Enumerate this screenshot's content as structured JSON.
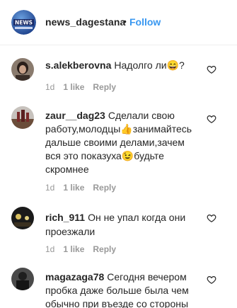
{
  "header": {
    "username": "news_dagestana",
    "separator": "•",
    "follow_label": "Follow",
    "avatar_text": "NEWS"
  },
  "comments": [
    {
      "username": "s.alekberovna",
      "text": "Надолго ли😄?",
      "time": "1d",
      "likes": "1 like",
      "reply": "Reply"
    },
    {
      "username": "zaur__dag23",
      "text": "Сделали свою работу,молодцы👍занимайтесь дальше своими делами,зачем вся это показуха😉будьте скромнее",
      "time": "1d",
      "likes": "1 like",
      "reply": "Reply"
    },
    {
      "username": "rich_911",
      "text": "Он не упал когда они проезжали",
      "time": "1d",
      "likes": "1 like",
      "reply": "Reply"
    },
    {
      "username": "magazaga78",
      "text": "Сегодня вечером пробка даже больше была чем обычно при въезде со стороны",
      "time": "",
      "likes": "",
      "reply": ""
    }
  ],
  "colors": {
    "link": "#3897f0",
    "text": "#262626",
    "muted": "#999999"
  }
}
